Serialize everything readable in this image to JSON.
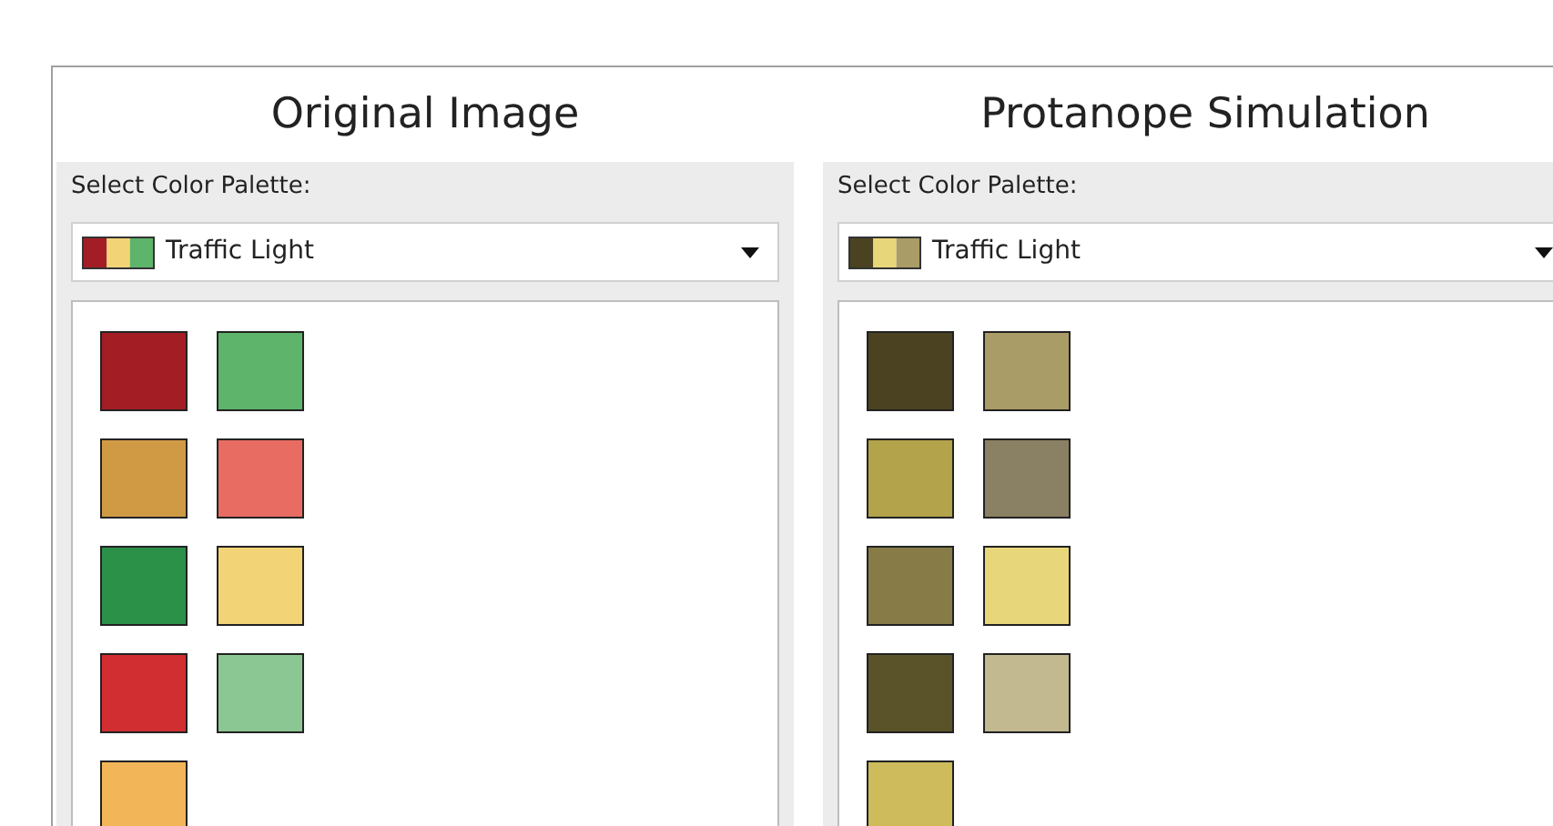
{
  "panels": [
    {
      "title": "Original Image",
      "palette_label": "Select Color Palette:",
      "palette": {
        "value": "Traffic Light"
      },
      "swatches": [
        {
          "color": "#a31d24"
        },
        {
          "color": "#5db46a"
        },
        {
          "color": "#d09a45"
        },
        {
          "color": "#e86c62"
        },
        {
          "color": "#2b9048"
        },
        {
          "color": "#f2d476"
        },
        {
          "color": "#d02e30"
        },
        {
          "color": "#8bc792"
        },
        {
          "color": "#f2b558"
        }
      ]
    },
    {
      "title": "Protanope Simulation",
      "palette_label": "Select Color Palette:",
      "palette": {
        "value": "Traffic Light"
      },
      "swatches": [
        {
          "color": "#4a4220"
        },
        {
          "color": "#a99c67"
        },
        {
          "color": "#b3a34a"
        },
        {
          "color": "#8a8063"
        },
        {
          "color": "#877c48"
        },
        {
          "color": "#e8d67a"
        },
        {
          "color": "#5a5228"
        },
        {
          "color": "#c2b990"
        },
        {
          "color": "#cdbb5c"
        }
      ]
    }
  ]
}
